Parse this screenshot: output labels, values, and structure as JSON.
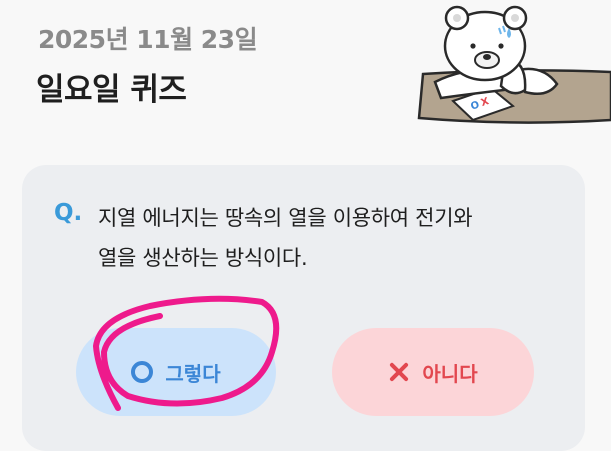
{
  "header": {
    "date": "2025년 11월 23일",
    "title": "일요일 퀴즈"
  },
  "quiz": {
    "q_mark": "Q.",
    "question_line1": "지열 에너지는 땅속의 열을 이용하여 전기와",
    "question_line2": "열을 생산하는 방식이다."
  },
  "answers": {
    "yes_label": "그렇다",
    "yes_icon": "circle-o-icon",
    "no_label": "아니다",
    "no_icon": "x-icon"
  },
  "mascot": {
    "note_text": "OX"
  },
  "colors": {
    "accent_blue": "#3b86d6",
    "accent_red": "#e2474f",
    "annotation_pink": "#ee1a8c"
  }
}
